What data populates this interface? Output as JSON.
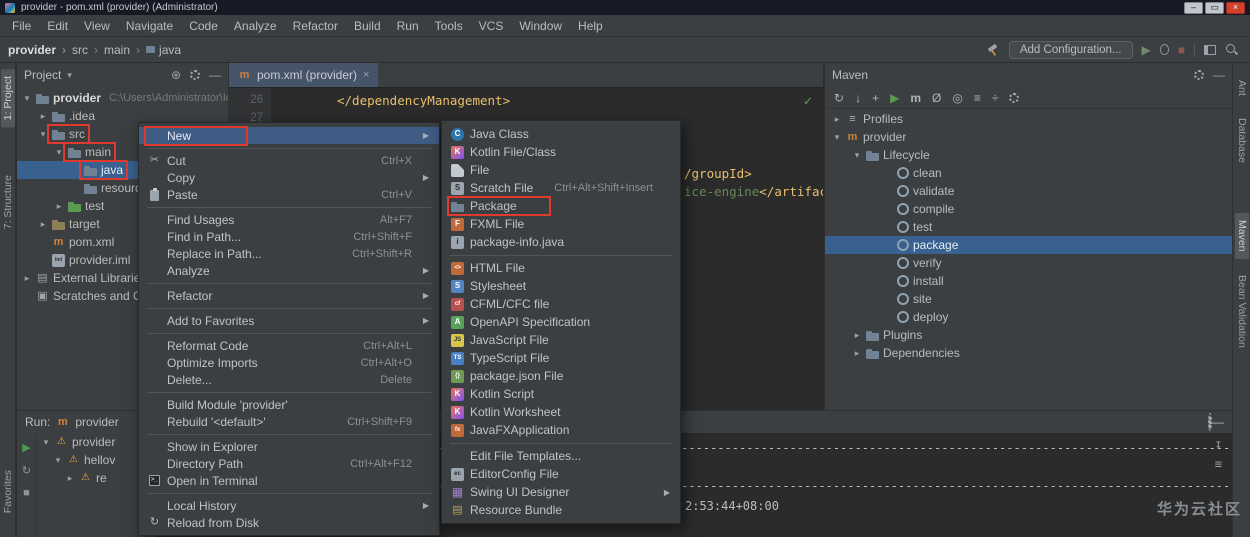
{
  "window": {
    "title": "provider - pom.xml (provider) (Administrator)",
    "controls": {
      "min": "–",
      "max": "▭",
      "close": "×"
    }
  },
  "menu_bar": {
    "items": [
      "File",
      "Edit",
      "View",
      "Navigate",
      "Code",
      "Analyze",
      "Refactor",
      "Build",
      "Run",
      "Tools",
      "VCS",
      "Window",
      "Help"
    ]
  },
  "navbar": {
    "crumbs": [
      "provider",
      "src",
      "main",
      "java"
    ],
    "add_configuration": "Add Configuration..."
  },
  "left_stripe": {
    "tabs": [
      {
        "label": "1: Project",
        "cls": "active"
      },
      {
        "label": "7: Structure",
        "cls": ""
      },
      {
        "label": "Favorites",
        "cls": ""
      }
    ]
  },
  "right_stripe": {
    "tabs": [
      {
        "label": "Ant",
        "cls": ""
      },
      {
        "label": "Database",
        "cls": ""
      },
      {
        "label": "Maven",
        "cls": "active"
      },
      {
        "label": "Bean Validation",
        "cls": ""
      }
    ]
  },
  "project": {
    "title": "Project",
    "tree": [
      {
        "cls": "lv0 bold",
        "arrow": "▾",
        "icon": "ic-folder",
        "label": "provider",
        "sub": "C:\\Users\\Administrator\\IdeaProjects\\p"
      },
      {
        "cls": "lv1",
        "arrow": "▸",
        "icon": "ic-folder",
        "label": ".idea",
        "sub": ""
      },
      {
        "cls": "lv1 annot",
        "arrow": "▾",
        "icon": "ic-folder",
        "label": "src",
        "sub": ""
      },
      {
        "cls": "lv2 annot",
        "arrow": "▾",
        "icon": "ic-folder",
        "label": "main",
        "sub": ""
      },
      {
        "cls": "lv3 sel annot",
        "arrow": "",
        "icon": "ic-folder",
        "label": "java",
        "sub": ""
      },
      {
        "cls": "lv3",
        "arrow": "",
        "icon": "ic-folder",
        "label": "resources",
        "sub": ""
      },
      {
        "cls": "lv2",
        "arrow": "▸",
        "icon": "ic-folder ic-test",
        "label": "test",
        "sub": ""
      },
      {
        "cls": "lv1",
        "arrow": "▸",
        "icon": "ic-folder ic-target",
        "label": "target",
        "sub": ""
      },
      {
        "cls": "lv1",
        "arrow": "",
        "icon": "ic-m",
        "label": "pom.xml",
        "sub": ""
      },
      {
        "cls": "lv1",
        "arrow": "",
        "icon": "ic-iml",
        "label": "provider.iml",
        "sub": ""
      },
      {
        "cls": "lv0",
        "arrow": "▸",
        "icon": "ic-extlib",
        "label": "External Libraries",
        "sub": ""
      },
      {
        "cls": "lv0",
        "arrow": "",
        "icon": "ic-scratches",
        "label": "Scratches and Consoles",
        "sub": ""
      }
    ]
  },
  "editor": {
    "tab_title": "pom.xml (provider)",
    "close": "×",
    "line1_num": "26",
    "line1_text": "</dependencyManagement>",
    "line2_num": "27",
    "frag_tag1": "/groupId>",
    "frag_str": "ice-engine",
    "frag_tag2": "</artifac",
    "check": "✓"
  },
  "maven": {
    "title": "Maven",
    "tree": [
      {
        "cls": "mt-lv0",
        "arrow": "▸",
        "icon": "ic-profiles",
        "label": "Profiles"
      },
      {
        "cls": "mt-lv0",
        "arrow": "▾",
        "icon": "ic-m",
        "label": "provider"
      },
      {
        "cls": "mt-lv1",
        "arrow": "▾",
        "icon": "ic-folder",
        "label": "Lifecycle"
      },
      {
        "cls": "mt-lv2",
        "arrow": "",
        "icon": "ic-goal",
        "label": "clean"
      },
      {
        "cls": "mt-lv2",
        "arrow": "",
        "icon": "ic-goal",
        "label": "validate"
      },
      {
        "cls": "mt-lv2",
        "arrow": "",
        "icon": "ic-goal",
        "label": "compile"
      },
      {
        "cls": "mt-lv2",
        "arrow": "",
        "icon": "ic-goal",
        "label": "test"
      },
      {
        "cls": "mt-lv2 sel",
        "arrow": "",
        "icon": "ic-goal",
        "label": "package"
      },
      {
        "cls": "mt-lv2",
        "arrow": "",
        "icon": "ic-goal",
        "label": "verify"
      },
      {
        "cls": "mt-lv2",
        "arrow": "",
        "icon": "ic-goal",
        "label": "install"
      },
      {
        "cls": "mt-lv2",
        "arrow": "",
        "icon": "ic-goal",
        "label": "site"
      },
      {
        "cls": "mt-lv2",
        "arrow": "",
        "icon": "ic-goal",
        "label": "deploy"
      },
      {
        "cls": "mt-lv1",
        "arrow": "▸",
        "icon": "ic-folder",
        "label": "Plugins"
      },
      {
        "cls": "mt-lv1",
        "arrow": "▸",
        "icon": "ic-folder",
        "label": "Dependencies"
      }
    ]
  },
  "context_menu": {
    "items": [
      {
        "cls": "sel annot",
        "icon": "",
        "label": "New",
        "shortcut": "",
        "arrow": "▶"
      },
      {
        "cls": "sep"
      },
      {
        "cls": "",
        "icon": "ic-cut",
        "label": "Cut",
        "shortcut": "Ctrl+X",
        "arrow": ""
      },
      {
        "cls": "",
        "icon": "",
        "label": "Copy",
        "shortcut": "",
        "arrow": "▶"
      },
      {
        "cls": "",
        "icon": "ic-paste",
        "label": "Paste",
        "shortcut": "Ctrl+V",
        "arrow": ""
      },
      {
        "cls": "sep"
      },
      {
        "cls": "",
        "icon": "",
        "label": "Find Usages",
        "shortcut": "Alt+F7",
        "arrow": ""
      },
      {
        "cls": "",
        "icon": "",
        "label": "Find in Path...",
        "shortcut": "Ctrl+Shift+F",
        "arrow": ""
      },
      {
        "cls": "",
        "icon": "",
        "label": "Replace in Path...",
        "shortcut": "Ctrl+Shift+R",
        "arrow": ""
      },
      {
        "cls": "",
        "icon": "",
        "label": "Analyze",
        "shortcut": "",
        "arrow": "▶"
      },
      {
        "cls": "sep"
      },
      {
        "cls": "",
        "icon": "",
        "label": "Refactor",
        "shortcut": "",
        "arrow": "▶"
      },
      {
        "cls": "sep"
      },
      {
        "cls": "",
        "icon": "",
        "label": "Add to Favorites",
        "shortcut": "",
        "arrow": "▶"
      },
      {
        "cls": "sep"
      },
      {
        "cls": "",
        "icon": "",
        "label": "Reformat Code",
        "shortcut": "Ctrl+Alt+L",
        "arrow": ""
      },
      {
        "cls": "",
        "icon": "",
        "label": "Optimize Imports",
        "shortcut": "Ctrl+Alt+O",
        "arrow": ""
      },
      {
        "cls": "",
        "icon": "",
        "label": "Delete...",
        "shortcut": "Delete",
        "arrow": ""
      },
      {
        "cls": "sep"
      },
      {
        "cls": "",
        "icon": "",
        "label": "Build Module 'provider'",
        "shortcut": "",
        "arrow": ""
      },
      {
        "cls": "",
        "icon": "",
        "label": "Rebuild '<default>'",
        "shortcut": "Ctrl+Shift+F9",
        "arrow": ""
      },
      {
        "cls": "sep"
      },
      {
        "cls": "",
        "icon": "",
        "label": "Show in Explorer",
        "shortcut": "",
        "arrow": ""
      },
      {
        "cls": "",
        "icon": "",
        "label": "Directory Path",
        "shortcut": "Ctrl+Alt+F12",
        "arrow": ""
      },
      {
        "cls": "",
        "icon": "ic-terminal",
        "label": "Open in Terminal",
        "shortcut": "",
        "arrow": ""
      },
      {
        "cls": "sep"
      },
      {
        "cls": "",
        "icon": "",
        "label": "Local History",
        "shortcut": "",
        "arrow": "▶"
      },
      {
        "cls": "",
        "icon": "ic-reload",
        "label": "Reload from Disk",
        "shortcut": "",
        "arrow": ""
      }
    ]
  },
  "new_submenu": {
    "items": [
      {
        "cls": "",
        "icon": "ic-class",
        "label": "Java Class",
        "shortcut": "",
        "arrow": ""
      },
      {
        "cls": "",
        "icon": "ic-kotlin",
        "label": "Kotlin File/Class",
        "shortcut": "",
        "arrow": ""
      },
      {
        "cls": "",
        "icon": "ic-filegen",
        "label": "File",
        "shortcut": "",
        "arrow": ""
      },
      {
        "cls": "",
        "icon": "ic-scratch",
        "label": "Scratch File",
        "shortcut": "Ctrl+Alt+Shift+Insert",
        "arrow": ""
      },
      {
        "cls": "annot",
        "icon": "ic-folder",
        "label": "Package",
        "shortcut": "",
        "arrow": ""
      },
      {
        "cls": "",
        "icon": "ic-fxml",
        "label": "FXML File",
        "shortcut": "",
        "arrow": ""
      },
      {
        "cls": "",
        "icon": "ic-pkginfo",
        "label": "package-info.java",
        "shortcut": "",
        "arrow": ""
      },
      {
        "cls": "sep"
      },
      {
        "cls": "",
        "icon": "ic-html",
        "label": "HTML File",
        "shortcut": "",
        "arrow": ""
      },
      {
        "cls": "",
        "icon": "ic-css",
        "label": "Stylesheet",
        "shortcut": "",
        "arrow": ""
      },
      {
        "cls": "",
        "icon": "ic-cfml",
        "label": "CFML/CFC file",
        "shortcut": "",
        "arrow": ""
      },
      {
        "cls": "",
        "icon": "ic-api",
        "label": "OpenAPI Specification",
        "shortcut": "",
        "arrow": ""
      },
      {
        "cls": "",
        "icon": "ic-js",
        "label": "JavaScript File",
        "shortcut": "",
        "arrow": ""
      },
      {
        "cls": "",
        "icon": "ic-ts",
        "label": "TypeScript File",
        "shortcut": "",
        "arrow": ""
      },
      {
        "cls": "",
        "icon": "ic-npm",
        "label": "package.json File",
        "shortcut": "",
        "arrow": ""
      },
      {
        "cls": "",
        "icon": "ic-kotlin",
        "label": "Kotlin Script",
        "shortcut": "",
        "arrow": ""
      },
      {
        "cls": "",
        "icon": "ic-kotlin",
        "label": "Kotlin Worksheet",
        "shortcut": "",
        "arrow": ""
      },
      {
        "cls": "",
        "icon": "ic-javafx",
        "label": "JavaFXApplication",
        "shortcut": "",
        "arrow": ""
      },
      {
        "cls": "sep"
      },
      {
        "cls": "",
        "icon": "",
        "label": "Edit File Templates...",
        "shortcut": "",
        "arrow": ""
      },
      {
        "cls": "",
        "icon": "ic-ec",
        "label": "EditorConfig File",
        "shortcut": "",
        "arrow": ""
      },
      {
        "cls": "",
        "icon": "ic-swing",
        "label": "Swing UI Designer",
        "shortcut": "",
        "arrow": "▶"
      },
      {
        "cls": "",
        "icon": "ic-rb",
        "label": "Resource Bundle",
        "shortcut": "",
        "arrow": ""
      }
    ]
  },
  "run": {
    "label": "Run:",
    "config": "provider",
    "tree": [
      {
        "cls": "rt-lv0",
        "arrow": "▾",
        "icon": "ic-warn",
        "label": "provider"
      },
      {
        "cls": "rt-lv1",
        "arrow": "▾",
        "icon": "ic-warn",
        "label": "hellov"
      },
      {
        "cls": "rt-lv2",
        "arrow": "▸",
        "icon": "ic-warn",
        "label": "re"
      }
    ],
    "console": {
      "line1": "------------------------------------------------------------------------------------------------------------------------------------------------------",
      "line2": "------------------------------------------------------------------------------------------------------------------------------------------------------",
      "line3": "2:53:44+08:00"
    }
  },
  "watermark": "华为云社区",
  "colors": {
    "selection_blue": "#38618f",
    "annotation_red": "#e0392e",
    "run_green": "#499c54",
    "xml_tag": "#e8bf6a",
    "xml_string": "#6a8759"
  },
  "icons": {
    "refresh": "↻",
    "download": "↓",
    "add": "+",
    "run": "▶",
    "maven": "m",
    "skip": "Ø",
    "offline": "◎",
    "toggle": "≡",
    "filter": "÷",
    "stop": "■",
    "chevron": "▾",
    "locate": "⊕",
    "hide": "—",
    "scroll_end": "↧",
    "soft_wrap": "≡",
    "check": "✓"
  }
}
